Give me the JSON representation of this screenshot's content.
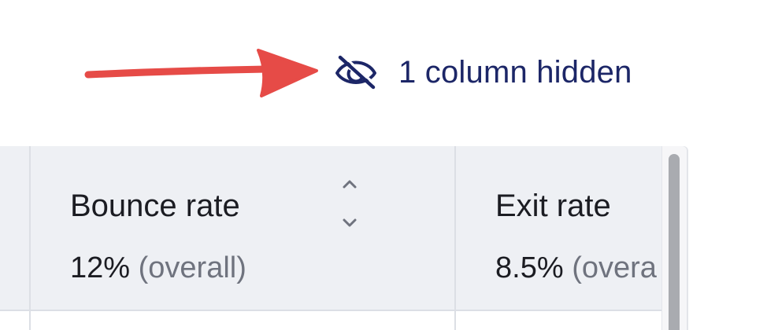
{
  "hidden_columns": {
    "label": "1 column hidden",
    "icon": "eye-slash-icon",
    "color": "#1c2667"
  },
  "annotation": {
    "icon": "red-arrow",
    "color": "#e64b47"
  },
  "table": {
    "columns": [
      {
        "title": "Bounce rate",
        "value": "12%",
        "qualifier": "(overall)",
        "sortable": true
      },
      {
        "title": "Exit rate",
        "value": "8.5%",
        "qualifier": "(overa"
      }
    ]
  }
}
